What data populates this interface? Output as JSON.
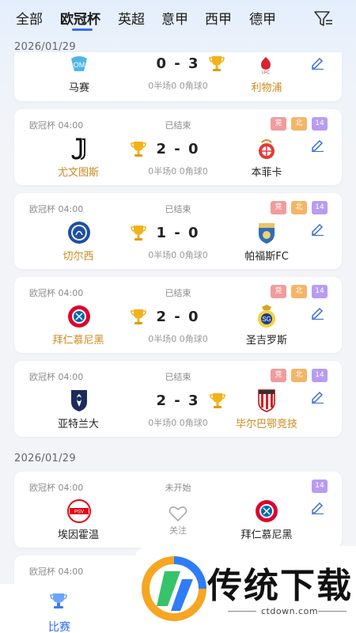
{
  "tabs": [
    "全部",
    "欧冠杯",
    "英超",
    "意甲",
    "西甲",
    "德甲"
  ],
  "active_tab": "欧冠杯",
  "dates": [
    "2026/01/29",
    "2026/01/29"
  ],
  "cards": [
    {
      "league": "",
      "status": "",
      "home": "马赛",
      "away": "利物浦",
      "score": "0 - 3",
      "stats": "0半场0 0角球0",
      "winner": "away",
      "badges": []
    },
    {
      "league": "欧冠杯 04:00",
      "status": "已结束",
      "home": "尤文图斯",
      "away": "本菲卡",
      "score": "2 - 0",
      "stats": "0半场0 0角球0",
      "winner": "home",
      "badges": [
        "竞",
        "北",
        "14"
      ]
    },
    {
      "league": "欧冠杯 04:00",
      "status": "已结束",
      "home": "切尔西",
      "away": "帕福斯FC",
      "score": "1 - 0",
      "stats": "0半场0 0角球0",
      "winner": "home",
      "badges": [
        "竞",
        "北",
        "14"
      ]
    },
    {
      "league": "欧冠杯 04:00",
      "status": "已结束",
      "home": "拜仁慕尼黑",
      "away": "圣吉罗斯",
      "score": "2 - 0",
      "stats": "0半场0 0角球0",
      "winner": "home",
      "badges": [
        "竞",
        "北",
        "14"
      ]
    },
    {
      "league": "欧冠杯 04:00",
      "status": "已结束",
      "home": "亚特兰大",
      "away": "毕尔巴鄂竞技",
      "score": "2 - 3",
      "stats": "0半场0 0角球0",
      "winner": "away",
      "badges": [
        "竞",
        "北",
        "14"
      ]
    },
    {
      "league": "欧冠杯 04:00",
      "status": "未开始",
      "home": "埃因霍温",
      "away": "拜仁慕尼黑",
      "score": "",
      "stats": "",
      "follow": "关注",
      "winner": "",
      "badges": [
        "14"
      ]
    },
    {
      "league": "欧冠杯 04:00",
      "status": "",
      "home": "",
      "away": "",
      "score": "",
      "stats": "",
      "winner": "",
      "badges": []
    }
  ],
  "bottom_nav": {
    "label": "比赛"
  },
  "watermark": {
    "brand": "传统下载",
    "url": "ctdown.com"
  },
  "colors": {
    "accent": "#2f6df6",
    "winner": "#d08a1e",
    "badge_jing": "#f09c9c",
    "badge_bei": "#f3b566",
    "badge_14": "#b89cf0"
  }
}
